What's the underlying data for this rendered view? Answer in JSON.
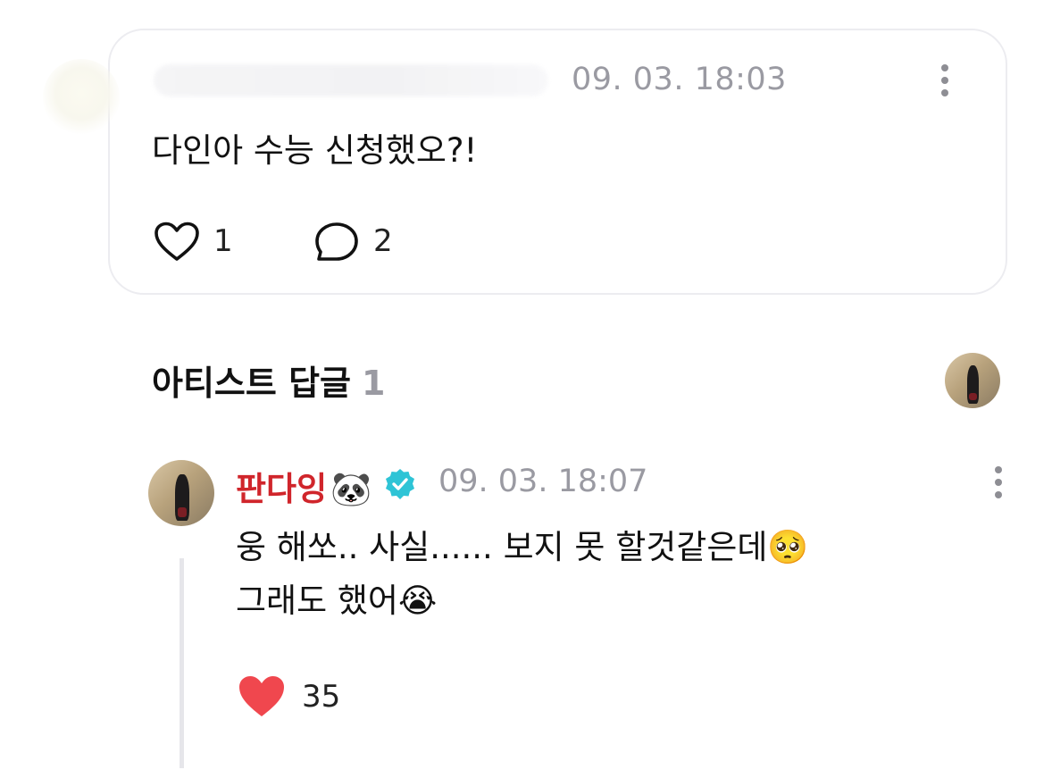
{
  "post": {
    "timestamp": "09. 03. 18:03",
    "text": "다인아 수능 신청했오?!",
    "like_count": "1",
    "comment_count": "2"
  },
  "artist_replies": {
    "title": "아티스트 답글",
    "count": "1"
  },
  "reply": {
    "author": "판다잉",
    "author_emoji": "🐼",
    "verified": true,
    "timestamp": "09. 03. 18:07",
    "text_line1": "웅 해쏘.. 사실...... 보지 못 할것같은데",
    "emoji1": "🥺",
    "text_line2": "그래도 했어",
    "emoji2": "😭",
    "like_count": "35"
  },
  "colors": {
    "artist_name": "#d0252b",
    "verified_badge": "#2ec4d6",
    "liked_heart": "#f0474e",
    "muted": "#9a9aa2"
  },
  "icons": [
    "heart-outline-icon",
    "comment-bubble-icon",
    "more-vertical-icon",
    "verified-badge-icon",
    "heart-filled-icon"
  ]
}
